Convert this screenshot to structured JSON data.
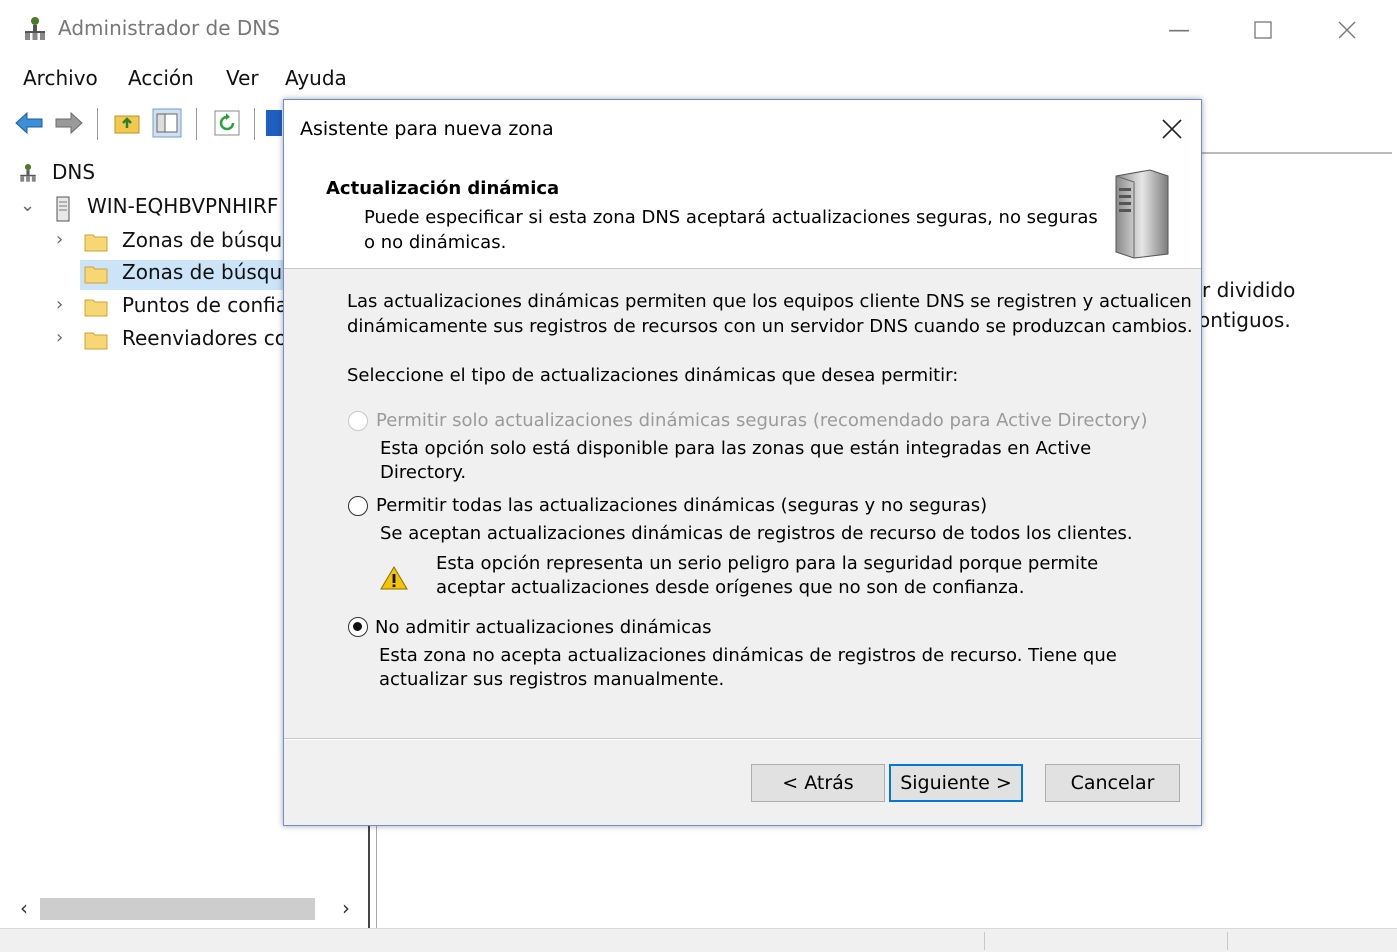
{
  "window": {
    "title": "Administrador de DNS",
    "min_icon": "minimize-icon",
    "max_icon": "maximize-icon",
    "close_icon": "close-icon"
  },
  "menu": {
    "items": [
      "Archivo",
      "Acción",
      "Ver",
      "Ayuda"
    ]
  },
  "toolbar": {
    "icons": [
      "back-arrow-icon",
      "forward-arrow-icon",
      "folder-up-icon",
      "show-hide-tree-icon",
      "refresh-icon",
      "help-icon"
    ]
  },
  "tree": {
    "root": "DNS",
    "server": "WIN-EQHBVPNHIRF",
    "children": [
      "Zonas de búsque",
      "Zonas de búsque",
      "Puntos de confia",
      "Reenviadores co"
    ]
  },
  "right_pane": {
    "fragment1": "r dividido",
    "fragment2": "ontiguos."
  },
  "dialog": {
    "title": "Asistente para nueva zona",
    "header_title": "Actualización dinámica",
    "header_desc": "Puede especificar si esta zona DNS aceptará actualizaciones seguras, no seguras o no dinámicas.",
    "intro_line1": "Las actualizaciones dinámicas permiten que los equipos cliente DNS se registren y actualicen",
    "intro_line2": "dinámicamente sus registros de recursos con un servidor DNS cuando se produzcan cambios.",
    "select_prompt": "Seleccione el tipo de actualizaciones dinámicas que desea permitir:",
    "options": [
      {
        "label": "Permitir solo actualizaciones dinámicas seguras (recomendado para Active Directory)",
        "desc_line1": "Esta opción solo está disponible para las zonas que están integradas en Active",
        "desc_line2": "Directory.",
        "enabled": false,
        "selected": false
      },
      {
        "label": "Permitir todas las actualizaciones dinámicas (seguras y no seguras)",
        "desc_line1": "Se aceptan actualizaciones dinámicas de registros de recurso de todos los clientes.",
        "warning_line1": "Esta opción representa un serio peligro para la seguridad porque permite",
        "warning_line2": "aceptar actualizaciones desde orígenes que no son de confianza.",
        "enabled": true,
        "selected": false
      },
      {
        "label": "No admitir actualizaciones dinámicas",
        "desc_line1": "Esta zona no acepta actualizaciones dinámicas de registros de recurso. Tiene que",
        "desc_line2": "actualizar sus registros manualmente.",
        "enabled": true,
        "selected": true
      }
    ],
    "buttons": {
      "back": "< Atrás",
      "next": "Siguiente >",
      "cancel": "Cancelar"
    }
  },
  "colors": {
    "dialog_border": "#6a8fd8",
    "default_button_border": "#0078d7",
    "warning": "#f5c400"
  }
}
